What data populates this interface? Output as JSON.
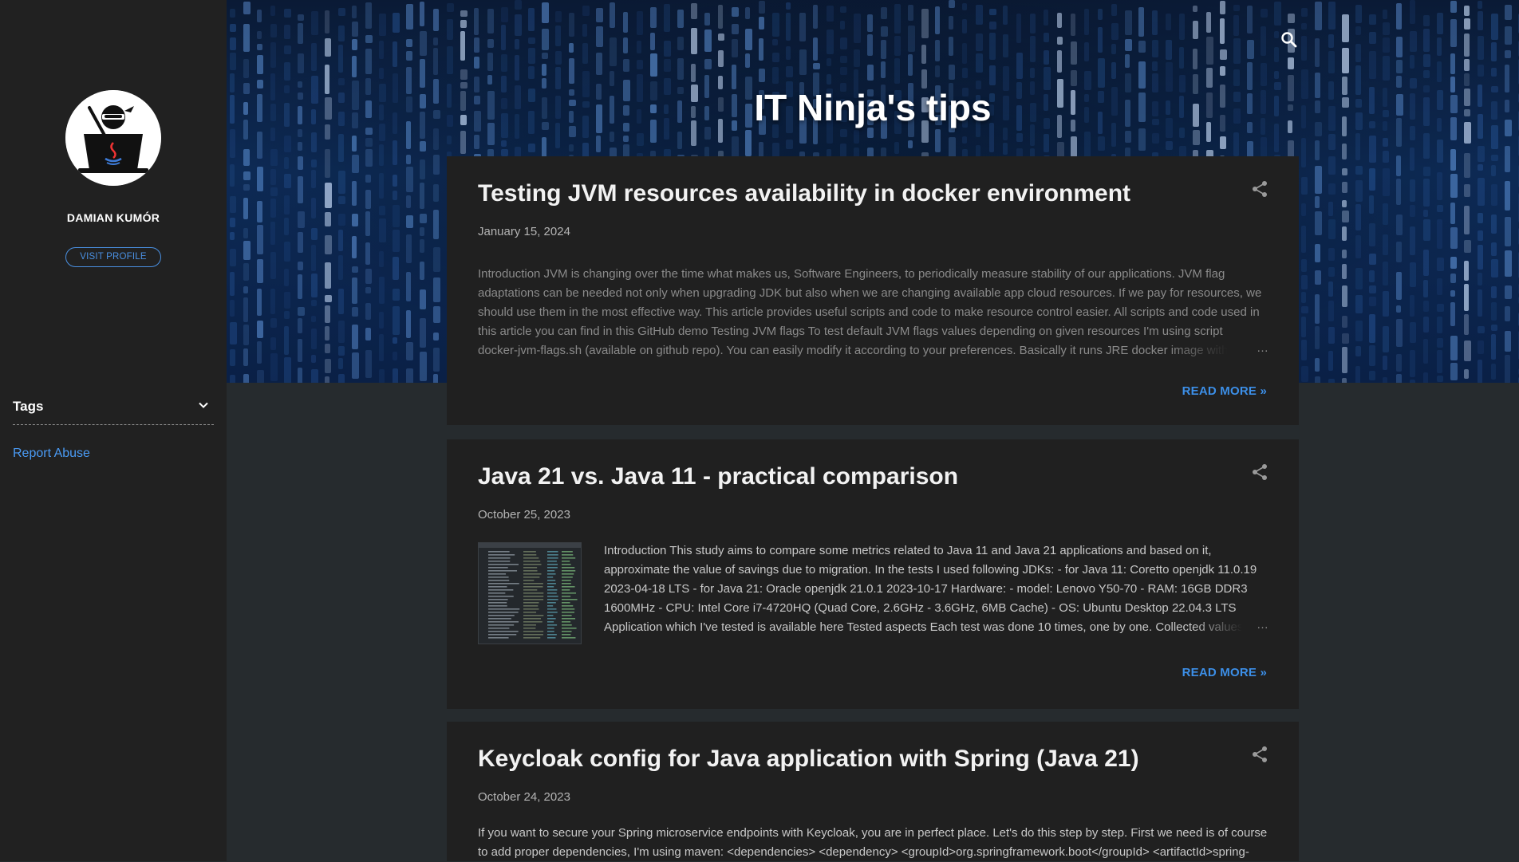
{
  "blog": {
    "title": "IT Ninja's tips"
  },
  "profile": {
    "name": "DAMIAN KUMÓR",
    "visit_label": "VISIT PROFILE"
  },
  "sidebar": {
    "tags_label": "Tags",
    "report_abuse": "Report Abuse"
  },
  "colors": {
    "accent": "#3c8fe8",
    "post_bg": "#202020",
    "page_bg": "#262b2e",
    "sidebar_bg": "#212121"
  },
  "posts": [
    {
      "title": "Testing JVM resources availability in docker environment",
      "date": "January 15, 2024",
      "snippet_lines": [
        "Introduction JVM is changing over the time what makes us, Software Engineers, to periodically measure stability of our applications. JVM flag",
        "adaptations can be needed not only when upgrading JDK but also when we are changing available app cloud resources. If we pay for resources, we",
        "should use them in the most effective way. This article provides useful scripts and code to make resource control easier. All scripts and code used in",
        "this article you can find in this GitHub demo Testing JVM flags To test default JVM flags values depending on given resources I'm using script",
        "docker-jvm-flags.sh (available on github repo). You can easily modify it according to your preferences. Basically it runs JRE docker image with giv"
      ],
      "ellipsis": "…",
      "read_more": "READ MORE »"
    },
    {
      "title": "Java 21 vs. Java 11 - practical comparison",
      "date": "October 25, 2023",
      "snippet_lines": [
        "Introduction This study aims to compare some metrics related to Java 11 and Java 21 applications and based on it,",
        "approximate the value of savings due to migration. In the tests I used following JDKs: - for Java 11: Coretto openjdk 11.0.19",
        "2023-04-18 LTS - for Java 21: Oracle openjdk 21.0.1 2023-10-17 Hardware: - model: Lenovo Y50-70 - RAM: 16GB DDR3",
        "1600MHz - CPU: Intel Core i7-4720HQ (Quad Core, 2.6GHz - 3.6GHz, 6MB Cache) - OS: Ubuntu Desktop 22.04.3 LTS",
        "Application which I've tested is available here Tested aspects Each test was done 10 times, one by one. Collected values"
      ],
      "ellipsis": "…",
      "read_more": "READ MORE »"
    },
    {
      "title": "Keycloak config for Java application with Spring (Java 21)",
      "date": "October 24, 2023",
      "snippet_lines": [
        "If you want to secure your Spring microservice endpoints with Keycloak, you are in perfect place. Let's do this step by step. First we need is of course",
        "to add proper dependencies, I'm using maven: <dependencies> <dependency> <groupId>org.springframework.boot</groupId> <artifactId>spring-"
      ]
    }
  ]
}
